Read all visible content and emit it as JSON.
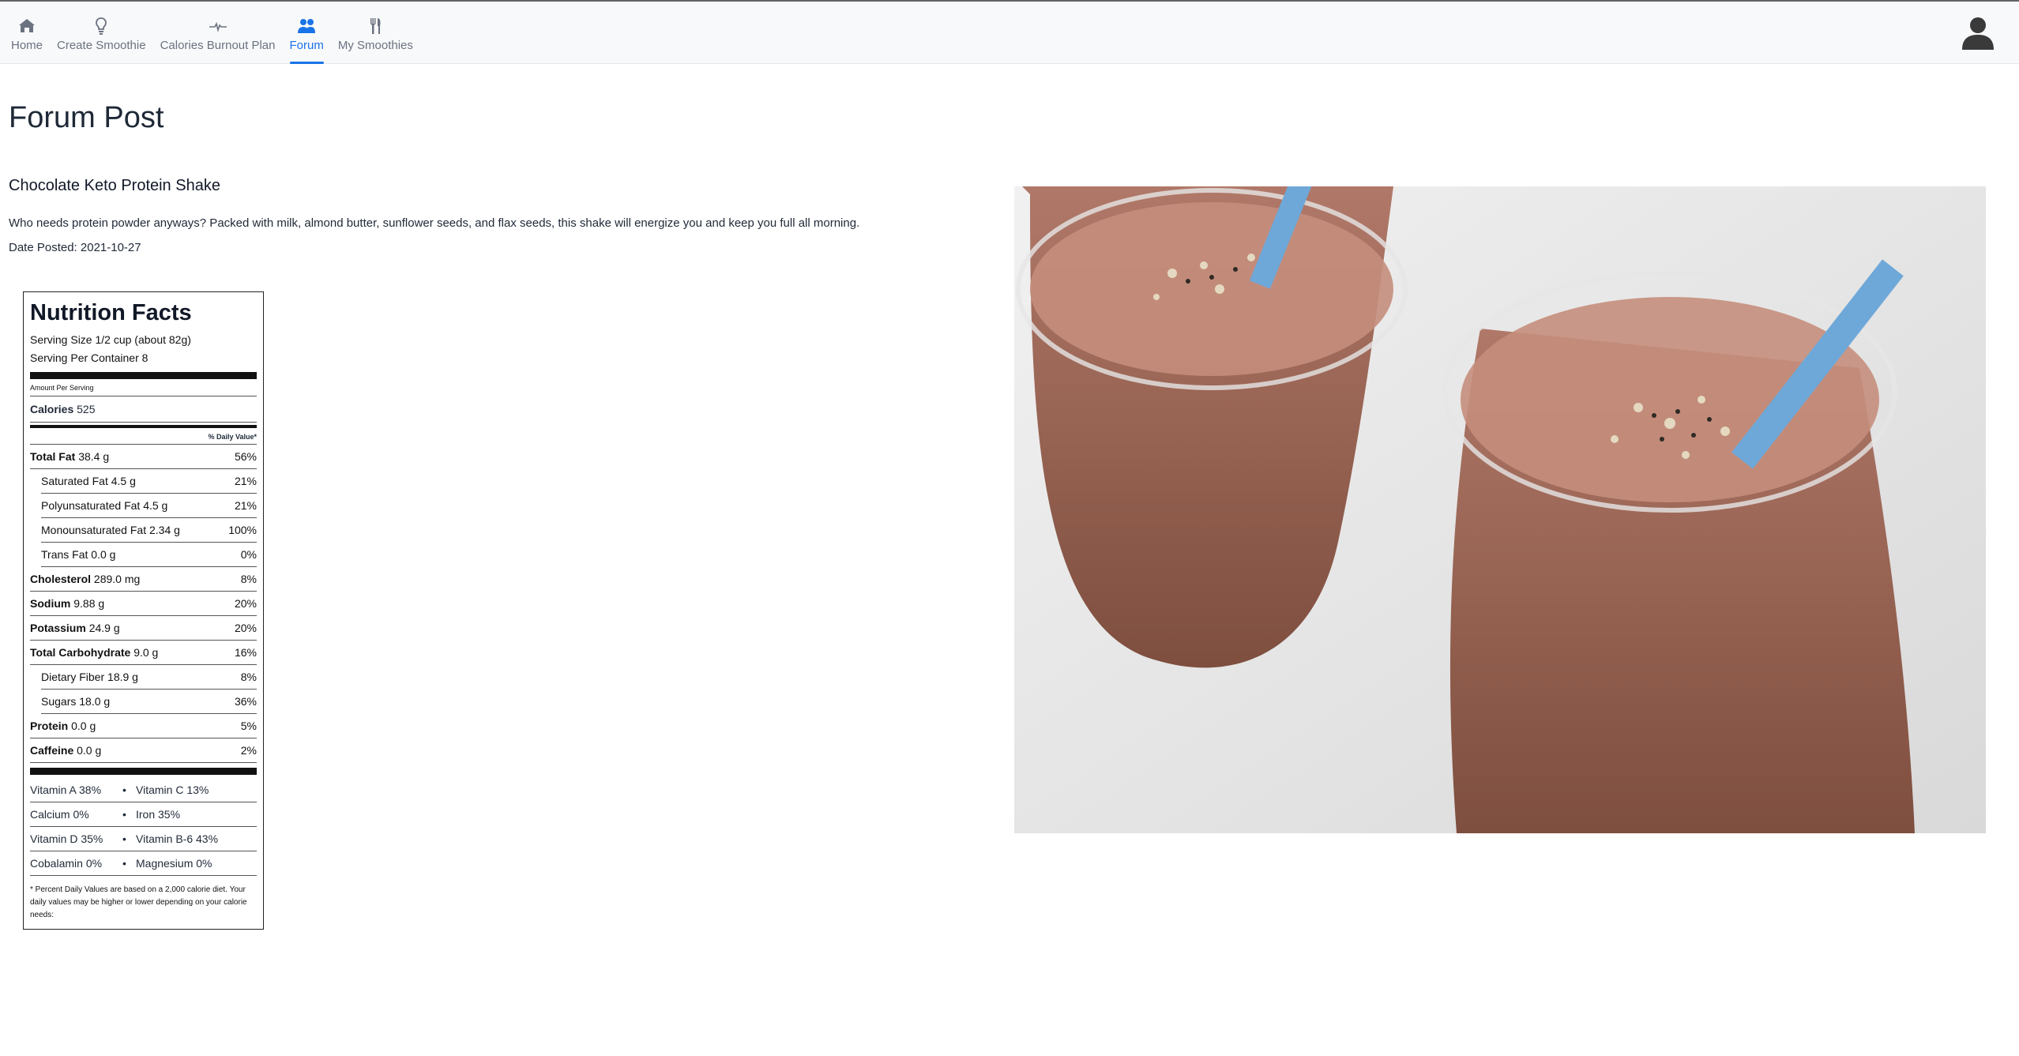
{
  "nav": {
    "items": [
      {
        "label": "Home",
        "icon": "home-icon"
      },
      {
        "label": "Create Smoothie",
        "icon": "lightbulb-icon"
      },
      {
        "label": "Calories Burnout Plan",
        "icon": "heartbeat-icon"
      },
      {
        "label": "Forum",
        "icon": "users-icon",
        "active": true
      },
      {
        "label": "My Smoothies",
        "icon": "utensils-icon"
      }
    ],
    "active_color": "#1a73e8"
  },
  "page": {
    "title": "Forum Post"
  },
  "post": {
    "title": "Chocolate Keto Protein Shake",
    "description": "Who needs protein powder anyways? Packed with milk, almond butter, sunflower seeds, and flax seeds, this shake will energize you and keep you full all morning.",
    "date_label": "Date Posted: 2021-10-27"
  },
  "nutrition": {
    "title": "Nutrition Facts",
    "serving_size": "Serving Size 1/2 cup (about 82g)",
    "servings_per_container": "Serving Per Container 8",
    "amount_per_serving": "Amount Per Serving",
    "calories_label": "Calories",
    "calories_value": "525",
    "dv_header": "% Daily Value*",
    "rows": [
      {
        "name": "Total Fat",
        "amount": "38.4 g",
        "dv": "56%",
        "bold": true
      },
      {
        "name": "Saturated Fat",
        "amount": "4.5 g",
        "dv": "21%"
      },
      {
        "name": "Polyunsaturated Fat",
        "amount": "4.5 g",
        "dv": "21%"
      },
      {
        "name": "Monounsaturated Fat",
        "amount": "2.34 g",
        "dv": "100%"
      },
      {
        "name": "Trans Fat",
        "amount": "0.0 g",
        "dv": "0%"
      },
      {
        "name": "Cholesterol",
        "amount": "289.0 mg",
        "dv": "8%",
        "bold": true
      },
      {
        "name": "Sodium",
        "amount": "9.88 g",
        "dv": "20%",
        "bold": true
      },
      {
        "name": "Potassium",
        "amount": "24.9 g",
        "dv": "20%",
        "bold": true
      },
      {
        "name": "Total Carbohydrate",
        "amount": "9.0 g",
        "dv": "16%",
        "bold": true
      },
      {
        "name": "Dietary Fiber",
        "amount": "18.9 g",
        "dv": "8%"
      },
      {
        "name": "Sugars",
        "amount": "18.0 g",
        "dv": "36%"
      },
      {
        "name": "Protein",
        "amount": "0.0 g",
        "dv": "5%",
        "bold": true
      },
      {
        "name": "Caffeine",
        "amount": "0.0 g",
        "dv": "2%",
        "bold": true
      }
    ],
    "vitamins": [
      {
        "left": "Vitamin A 38%",
        "right": "Vitamin C 13%"
      },
      {
        "left": "Calcium 0%",
        "right": "Iron 35%"
      },
      {
        "left": "Vitamin D 35%",
        "right": "Vitamin B-6 43%"
      },
      {
        "left": "Cobalamin 0%",
        "right": "Magnesium 0%"
      }
    ],
    "bullet": "•",
    "footnote": "* Percent Daily Values are based on a 2,000 calorie diet. Your daily values may be higher or lower depending on your calorie needs:"
  }
}
